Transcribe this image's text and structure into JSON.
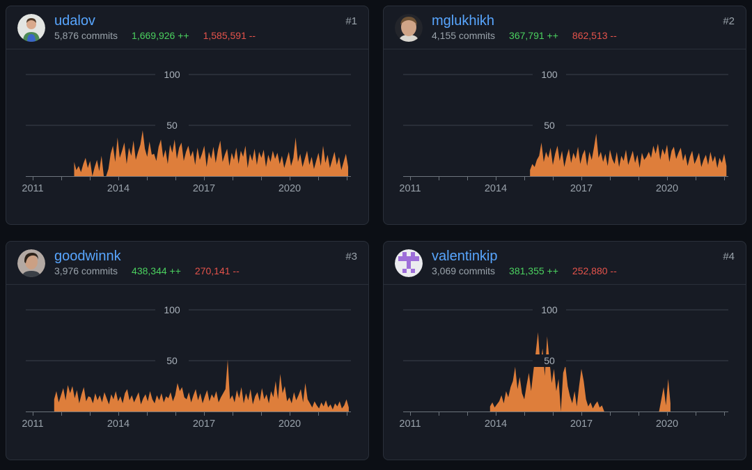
{
  "colors": {
    "page_bg": "#0c0f15",
    "card_bg": "#171b24",
    "card_border": "#2a303a",
    "username_link": "#58a6ff",
    "muted_text": "#9aa3ab",
    "additions_green": "#4bd15f",
    "deletions_red": "#e5534b",
    "bar": "#de7e3b",
    "gridline": "#3b414c",
    "axis": "#6e757d",
    "x_label": "#99a2ab",
    "y_label": "#abb3bc",
    "identicon_purple": "#9e6ed9"
  },
  "cards": [
    {
      "rank": "#1",
      "username": "udalov",
      "commits_label": "5,876 commits",
      "additions_label": "1,669,926 ++",
      "deletions_label": "1,585,591 --"
    },
    {
      "rank": "#2",
      "username": "mglukhikh",
      "commits_label": "4,155 commits",
      "additions_label": "367,791 ++",
      "deletions_label": "862,513 --"
    },
    {
      "rank": "#3",
      "username": "goodwinnk",
      "commits_label": "3,976 commits",
      "additions_label": "438,344 ++",
      "deletions_label": "270,141 --"
    },
    {
      "rank": "#4",
      "username": "valentinkip",
      "commits_label": "3,069 commits",
      "additions_label": "381,355 ++",
      "deletions_label": "252,880 --"
    }
  ],
  "chart_data": [
    {
      "type": "area",
      "series_name": "udalov weekly commits",
      "ylim": [
        0,
        100
      ],
      "y_gridlines": [
        50,
        100
      ],
      "y_tick_labels": [
        "50",
        "100"
      ],
      "x_ticks": [
        2011,
        2012,
        2013,
        2014,
        2015,
        2016,
        2017,
        2018,
        2019,
        2020,
        2021,
        2022
      ],
      "x_tick_labels": [
        {
          "year": 2011,
          "label": "2011"
        },
        {
          "year": 2014,
          "label": "2014"
        },
        {
          "year": 2017,
          "label": "2017"
        },
        {
          "year": 2020,
          "label": "2020"
        }
      ],
      "x_start": 2012.45,
      "x_step": 0.08,
      "values": [
        14,
        6,
        10,
        4,
        12,
        18,
        8,
        15,
        0,
        9,
        16,
        5,
        20,
        0,
        0,
        7,
        22,
        30,
        14,
        38,
        18,
        25,
        33,
        12,
        28,
        20,
        35,
        16,
        24,
        31,
        45,
        27,
        19,
        34,
        21,
        22,
        15,
        29,
        36,
        18,
        26,
        12,
        31,
        23,
        36,
        17,
        28,
        33,
        15,
        24,
        30,
        19,
        25,
        11,
        28,
        16,
        22,
        30,
        9,
        24,
        17,
        29,
        13,
        26,
        35,
        14,
        21,
        27,
        10,
        23,
        16,
        28,
        12,
        25,
        19,
        30,
        8,
        22,
        15,
        27,
        11,
        24,
        18,
        26,
        9,
        21,
        14,
        25,
        17,
        23,
        12,
        20,
        8,
        16,
        24,
        10,
        18,
        38,
        14,
        22,
        9,
        17,
        25,
        11,
        19,
        7,
        15,
        23,
        10,
        30,
        13,
        21,
        8,
        16,
        24,
        11,
        19,
        6,
        14,
        22,
        9
      ]
    },
    {
      "type": "area",
      "series_name": "mglukhikh weekly commits",
      "ylim": [
        0,
        100
      ],
      "y_gridlines": [
        50,
        100
      ],
      "y_tick_labels": [
        "50",
        "100"
      ],
      "x_ticks": [
        2011,
        2012,
        2013,
        2014,
        2015,
        2016,
        2017,
        2018,
        2019,
        2020,
        2021,
        2022
      ],
      "x_tick_labels": [
        {
          "year": 2011,
          "label": "2011"
        },
        {
          "year": 2014,
          "label": "2014"
        },
        {
          "year": 2017,
          "label": "2017"
        },
        {
          "year": 2020,
          "label": "2020"
        }
      ],
      "x_start": 2015.2,
      "x_step": 0.08,
      "values": [
        6,
        12,
        9,
        16,
        20,
        33,
        14,
        24,
        18,
        28,
        11,
        22,
        30,
        15,
        25,
        9,
        19,
        27,
        13,
        23,
        17,
        29,
        12,
        21,
        26,
        10,
        24,
        16,
        28,
        42,
        18,
        24,
        14,
        22,
        10,
        26,
        17,
        12,
        24,
        9,
        20,
        15,
        26,
        11,
        18,
        25,
        13,
        21,
        8,
        23,
        16,
        19,
        24,
        18,
        30,
        22,
        32,
        16,
        27,
        21,
        31,
        14,
        25,
        29,
        17,
        23,
        28,
        15,
        22,
        10,
        19,
        25,
        12,
        17,
        23,
        9,
        16,
        21,
        11,
        24,
        14,
        20,
        8,
        18,
        13,
        22,
        10
      ]
    },
    {
      "type": "area",
      "series_name": "goodwinnk weekly commits",
      "ylim": [
        0,
        100
      ],
      "y_gridlines": [
        50,
        100
      ],
      "y_tick_labels": [
        "50",
        "100"
      ],
      "x_ticks": [
        2011,
        2012,
        2013,
        2014,
        2015,
        2016,
        2017,
        2018,
        2019,
        2020,
        2021,
        2022
      ],
      "x_tick_labels": [
        {
          "year": 2011,
          "label": "2011"
        },
        {
          "year": 2014,
          "label": "2014"
        },
        {
          "year": 2017,
          "label": "2017"
        },
        {
          "year": 2020,
          "label": "2020"
        }
      ],
      "x_start": 2011.75,
      "x_step": 0.08,
      "values": [
        12,
        20,
        9,
        16,
        23,
        11,
        26,
        18,
        25,
        13,
        21,
        8,
        17,
        24,
        10,
        15,
        14,
        8,
        18,
        11,
        16,
        9,
        19,
        13,
        7,
        17,
        12,
        20,
        10,
        15,
        8,
        18,
        22,
        11,
        16,
        9,
        14,
        19,
        7,
        13,
        17,
        10,
        20,
        12,
        8,
        16,
        11,
        18,
        9,
        15,
        13,
        19,
        10,
        16,
        28,
        20,
        24,
        14,
        12,
        19,
        9,
        16,
        22,
        11,
        18,
        8,
        15,
        21,
        10,
        17,
        13,
        20,
        9,
        14,
        18,
        22,
        51,
        12,
        16,
        9,
        21,
        13,
        24,
        8,
        18,
        11,
        22,
        7,
        15,
        19,
        10,
        23,
        12,
        17,
        8,
        20,
        14,
        30,
        12,
        37,
        18,
        25,
        10,
        14,
        8,
        19,
        11,
        16,
        22,
        9,
        28,
        12,
        8,
        4,
        10,
        6,
        3,
        9,
        5,
        11,
        4,
        7,
        2,
        8,
        5,
        10,
        3,
        6,
        12,
        4
      ]
    },
    {
      "type": "area",
      "series_name": "valentinkip weekly commits",
      "ylim": [
        0,
        100
      ],
      "y_gridlines": [
        50,
        100
      ],
      "y_tick_labels": [
        "50",
        "100"
      ],
      "x_ticks": [
        2011,
        2012,
        2013,
        2014,
        2015,
        2016,
        2017,
        2018,
        2019,
        2020,
        2021,
        2022
      ],
      "x_tick_labels": [
        {
          "year": 2011,
          "label": "2011"
        },
        {
          "year": 2014,
          "label": "2014"
        },
        {
          "year": 2017,
          "label": "2017"
        },
        {
          "year": 2020,
          "label": "2020"
        }
      ],
      "x_start": 2013.8,
      "x_step": 0.08,
      "values": [
        5,
        9,
        4,
        7,
        10,
        16,
        8,
        20,
        14,
        24,
        30,
        44,
        22,
        34,
        18,
        12,
        26,
        38,
        20,
        40,
        58,
        78,
        45,
        62,
        35,
        74,
        50,
        28,
        42,
        20,
        32,
        0,
        38,
        45,
        25,
        15,
        8,
        20,
        5,
        25,
        42,
        30,
        12,
        5,
        9,
        3,
        7,
        10,
        4,
        6,
        0,
        0,
        0,
        0,
        0,
        0,
        0,
        0,
        0,
        0,
        0,
        0,
        0,
        0,
        0,
        0,
        0,
        0,
        0,
        0,
        0,
        0,
        0,
        0,
        0,
        12,
        24,
        6,
        32,
        8
      ]
    }
  ]
}
